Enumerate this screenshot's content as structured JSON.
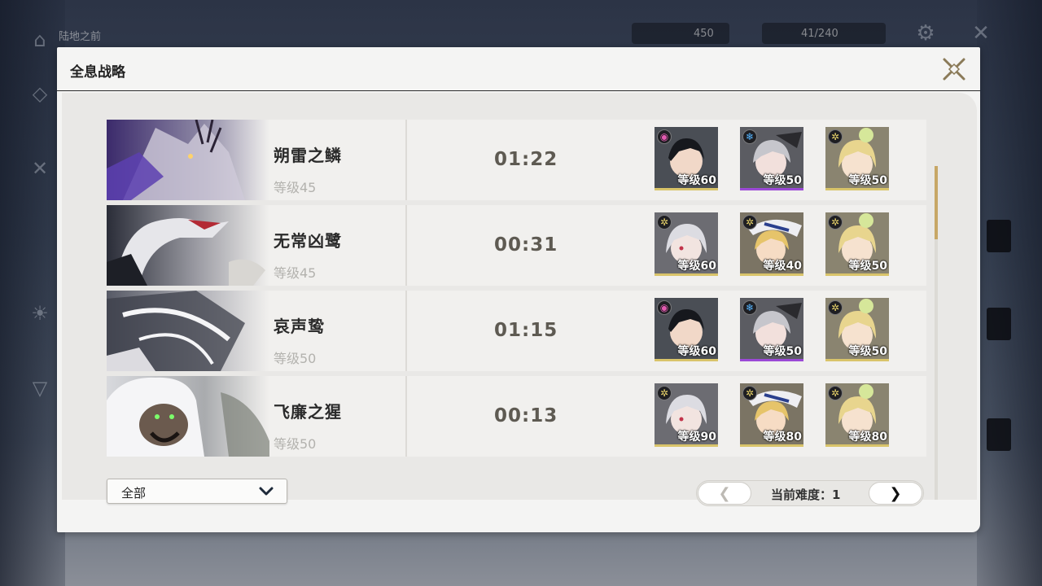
{
  "background": {
    "top_left_label": "陆地之前",
    "currency_value": "450",
    "stamina_value": "41/240"
  },
  "panel": {
    "title": "全息战略"
  },
  "bosses": [
    {
      "name": "朔雷之鳞",
      "level": "等级45",
      "time": "01:22",
      "team": [
        {
          "elem": "havoc",
          "level": "等级60",
          "rarity": "gold"
        },
        {
          "elem": "glacio",
          "level": "等级50",
          "rarity": "purple"
        },
        {
          "elem": "spectro",
          "level": "等级50",
          "rarity": "gold"
        }
      ]
    },
    {
      "name": "无常凶鹭",
      "level": "等级45",
      "time": "00:31",
      "team": [
        {
          "elem": "spectro",
          "level": "等级60",
          "rarity": "gold"
        },
        {
          "elem": "spectro",
          "level": "等级40",
          "rarity": "gold"
        },
        {
          "elem": "spectro",
          "level": "等级50",
          "rarity": "gold"
        }
      ]
    },
    {
      "name": "哀声鸷",
      "level": "等级50",
      "time": "01:15",
      "team": [
        {
          "elem": "havoc",
          "level": "等级60",
          "rarity": "gold"
        },
        {
          "elem": "glacio",
          "level": "等级50",
          "rarity": "purple"
        },
        {
          "elem": "spectro",
          "level": "等级50",
          "rarity": "gold"
        }
      ]
    },
    {
      "name": "飞廉之猩",
      "level": "等级50",
      "time": "00:13",
      "team": [
        {
          "elem": "spectro",
          "level": "等级90",
          "rarity": "gold"
        },
        {
          "elem": "spectro",
          "level": "等级80",
          "rarity": "gold"
        },
        {
          "elem": "spectro",
          "level": "等级80",
          "rarity": "gold"
        }
      ]
    }
  ],
  "footer": {
    "filter_value": "全部",
    "difficulty_label": "当前难度：1",
    "prev_symbol": "❮",
    "next_symbol": "❯"
  },
  "colors": {
    "accent_gold": "#c7a766",
    "rarity_gold": "#d9c46a",
    "rarity_purple": "#9b49d6"
  }
}
